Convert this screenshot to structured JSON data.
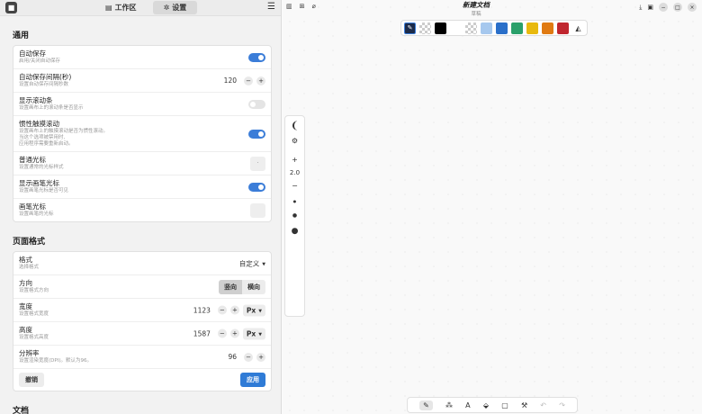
{
  "left_pane": {
    "app_icon": "app-logo-icon",
    "tabs": [
      {
        "label": "工作区",
        "icon": "workspace-icon"
      },
      {
        "label": "设置",
        "icon": "gear-icon"
      }
    ],
    "menu_icon": "hamburger-menu-icon"
  },
  "sections": {
    "general": {
      "title": "通用",
      "rows": {
        "autosave": {
          "label": "自动保存",
          "desc": "启用/关闭自动保存",
          "on": true
        },
        "autosave_interval": {
          "label": "自动保存间隔(秒)",
          "desc": "设置自动保存间隔秒数",
          "value": "120"
        },
        "show_scrollbar": {
          "label": "显示滚动条",
          "desc": "设置画布上的滚动条是否显示",
          "on": false
        },
        "inertia_scroll": {
          "label": "惯性触摸滚动",
          "desc1": "设置画布上的触摸滚动是否为惯性滚动。",
          "desc2": "当这个选项被禁用时,",
          "desc3": "应用程序需要重新启动。",
          "on": true
        },
        "normal_cursor": {
          "label": "普通光标",
          "desc": "设置通常的光标样式"
        },
        "show_brush_cursor": {
          "label": "显示画笔光标",
          "desc": "设置画笔光标是否可见",
          "on": true
        },
        "brush_cursor": {
          "label": "画笔光标",
          "desc": "设置画笔的光标"
        }
      }
    },
    "page_format": {
      "title": "页面格式",
      "rows": {
        "format": {
          "label": "格式",
          "desc": "选择格式",
          "value": "自定义"
        },
        "orientation": {
          "label": "方向",
          "desc": "设置格式方向",
          "options": [
            "竖向",
            "横向"
          ],
          "selected": "竖向"
        },
        "width": {
          "label": "宽度",
          "desc": "设置格式宽度",
          "value": "1123",
          "unit": "Px"
        },
        "height": {
          "label": "高度",
          "desc": "设置格式高度",
          "value": "1587",
          "unit": "Px"
        },
        "resolution": {
          "label": "分辨率",
          "desc": "设置渲染宽度(DPI)。默认为96。",
          "value": "96"
        }
      },
      "cancel_label": "撤销",
      "apply_label": "应用"
    },
    "document": {
      "title": "文档"
    }
  },
  "document_header": {
    "title": "新建文档",
    "subtitle": "草稿"
  },
  "palette": {
    "colors": [
      "#000000",
      "#ffffff",
      "checker",
      "#a6c8ee",
      "#2a6fc9",
      "#2aa06a",
      "#e8b90e",
      "#e07a12",
      "#c0262e"
    ]
  },
  "tool_panel": {
    "stroke_width": "2.0"
  }
}
